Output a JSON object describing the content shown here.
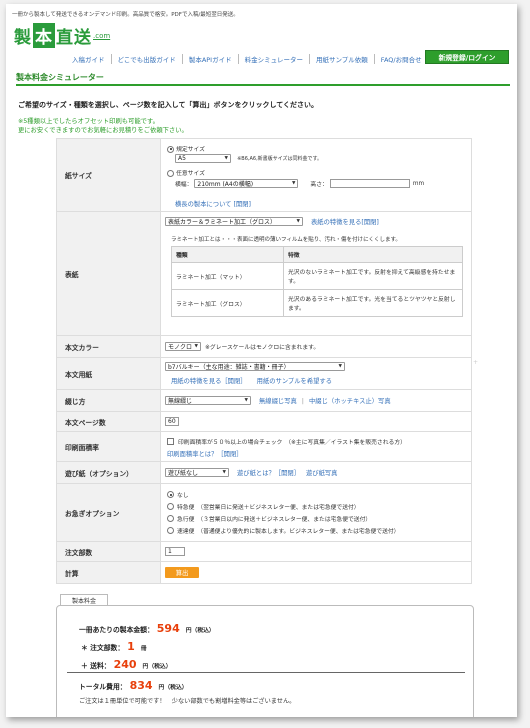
{
  "header": {
    "tagline": "一冊から製本して発送できるオンデマンド印刷。高品質で格安。PDFで入稿/最短翌日発送。",
    "logo_part1": "製",
    "logo_part2": "本",
    "logo_part3": "直送",
    "logo_com": ".com",
    "login_button": "新規登録/ログイン"
  },
  "nav": {
    "items": [
      "入稿ガイド",
      "どこでも出版ガイド",
      "製本APIガイド",
      "料金シミュレーター",
      "用紙サンプル依頼",
      "FAQ/お問合せ"
    ]
  },
  "page": {
    "title": "製本料金シミュレーター",
    "instruction": "ご希望のサイズ・種類を選択し、ページ数を記入して「算出」ボタンをクリックしてください。",
    "note1": "※5種類以上でしたらオフセット印刷も可能です。",
    "note2": "更にお安くできますのでお気軽にお見積りをご依頼下さい。"
  },
  "form": {
    "paper_size": {
      "label": "紙サイズ",
      "opt_standard": "規定サイズ",
      "standard_value": "A5",
      "standard_note": "※B6,A6,新書版サイズは同料金です。",
      "opt_custom": "任意サイズ",
      "width_label": "横幅：",
      "width_value": "210mm (A4の横幅)",
      "height_label": "高さ：",
      "height_unit": "mm",
      "about_link": "横長の製本について [開閉]"
    },
    "cover": {
      "label": "表紙",
      "value": "表紙カラー＆ラミネート加工（グロス）",
      "feature_link": "表紙の特徴を見る[開閉]",
      "lam_desc": "ラミネート加工とは・・・表面に透明の薄いフィルムを貼り、汚れ・傷を付けにくくします。",
      "col_type": "種類",
      "col_feature": "特徴",
      "rows": [
        {
          "type": "ラミネート加工（マット）",
          "feature": "光沢のないラミネート加工です。反射を抑えて高級感を持たせます。"
        },
        {
          "type": "ラミネート加工（グロス）",
          "feature": "光沢のあるラミネート加工です。光を当てるとツヤツヤと反射します。"
        }
      ]
    },
    "body_color": {
      "label": "本文カラー",
      "value": "モノクロ",
      "note": "※グレースケールはモノクロに含まれます。"
    },
    "body_paper": {
      "label": "本文用紙",
      "value": "b7バルキー（主な用途：雑誌・書籍・冊子）",
      "link1": "用紙の特徴を見る［開閉］",
      "link2": "用紙のサンプルを希望する"
    },
    "binding": {
      "label": "綴じ方",
      "value": "無線綴じ",
      "link1": "無線綴じ写真",
      "link2": "中綴じ（ホッチキス止）写真"
    },
    "pages": {
      "label": "本文ページ数",
      "value": "60"
    },
    "coverage": {
      "label": "印刷面積率",
      "check_label": "印刷面積率が５０％以上の場合チェック　（※主に写真集／イラスト集を販売される方）",
      "link": "印刷面積率とは？［開閉］"
    },
    "endpaper": {
      "label": "遊び紙（オプション）",
      "value": "遊び紙なし",
      "link1": "遊び紙とは？［開閉］",
      "link2": "遊び紙写真"
    },
    "rush": {
      "label": "お急ぎオプション",
      "options": [
        "なし",
        "特急便　（翌営業日に発送＋ビジネスレター便、または宅急便で送付）",
        "急行便　（３営業日以内に発送＋ビジネスレター便、または宅急便で送付）",
        "速達便　（普通便より優先的に製本します。ビジネスレター便、または宅急便で送付）"
      ]
    },
    "quantity": {
      "label": "注文部数",
      "value": "1"
    },
    "calc": {
      "label": "計算",
      "button": "算出"
    }
  },
  "result": {
    "tab": "製本料金",
    "unit_price_label": "一冊あたりの製本金額：",
    "unit_price_value": "594",
    "yen_taxin": "円（税込）",
    "qty_label": "＊ 注文部数：",
    "qty_value": "1",
    "qty_unit": "冊",
    "shipping_label": "＋ 送料：",
    "shipping_value": "240",
    "total_label": "トータル費用：",
    "total_value": "834",
    "footer_note": "ご注文は１冊単位で可能です！　少ない部数でも割増料金等はございません。"
  }
}
